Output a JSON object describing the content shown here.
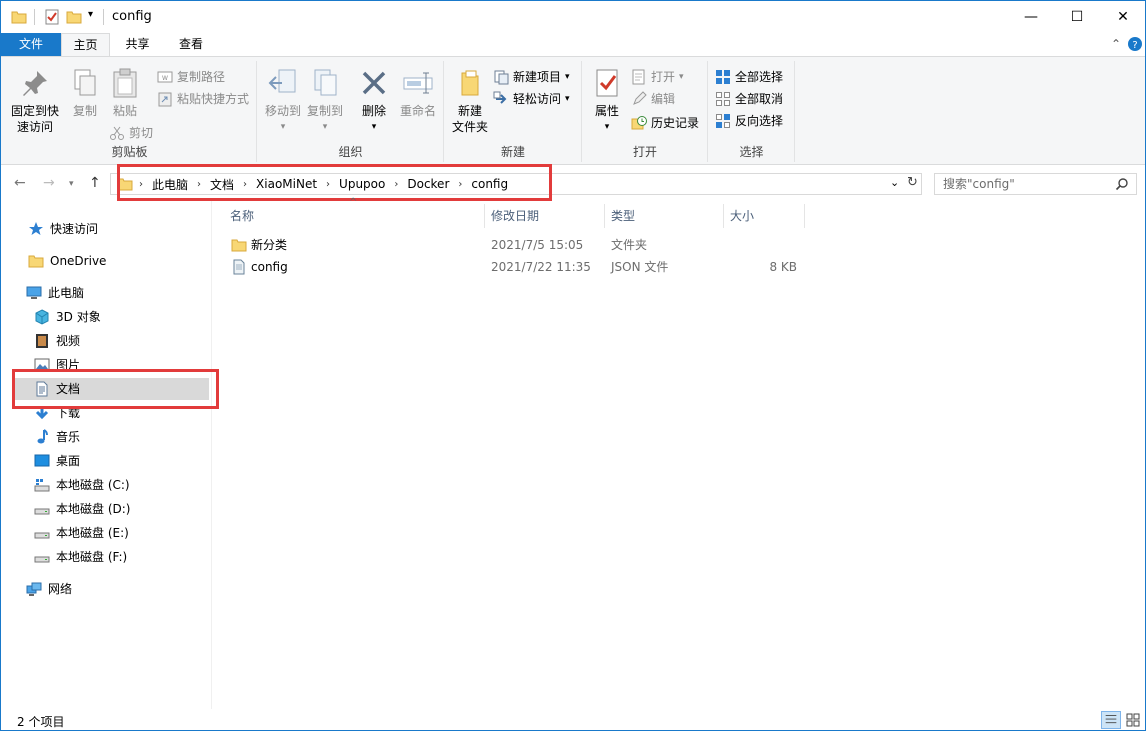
{
  "window": {
    "title": "config",
    "minimize_glyph": "—",
    "maximize_glyph": "☐",
    "close_glyph": "✕"
  },
  "ribbon_tabs": {
    "file": "文件",
    "home": "主页",
    "share": "共享",
    "view": "查看"
  },
  "ribbon": {
    "clipboard": {
      "label": "剪贴板",
      "pin_line1": "固定到快",
      "pin_line2": "速访问",
      "copy": "复制",
      "paste": "粘贴",
      "copy_path": "复制路径",
      "paste_shortcut": "粘贴快捷方式",
      "cut": "剪切"
    },
    "organize": {
      "label": "组织",
      "move_to": "移动到",
      "copy_to": "复制到",
      "delete": "删除",
      "rename": "重命名"
    },
    "new": {
      "label": "新建",
      "new_folder_line1": "新建",
      "new_folder_line2": "文件夹",
      "new_item": "新建项目",
      "easy_access": "轻松访问"
    },
    "open": {
      "label": "打开",
      "properties": "属性",
      "open": "打开",
      "edit": "编辑",
      "history": "历史记录"
    },
    "select": {
      "label": "选择",
      "select_all": "全部选择",
      "select_none": "全部取消",
      "invert": "反向选择"
    }
  },
  "address": {
    "crumbs": [
      "此电脑",
      "文档",
      "XiaoMiNet",
      "Upupoo",
      "Docker",
      "config"
    ]
  },
  "search": {
    "placeholder": "搜索\"config\""
  },
  "nav": {
    "quick_access": "快速访问",
    "onedrive": "OneDrive",
    "this_pc": "此电脑",
    "objects3d": "3D 对象",
    "videos": "视频",
    "pictures": "图片",
    "documents": "文档",
    "downloads": "下载",
    "music": "音乐",
    "desktop": "桌面",
    "drive_c": "本地磁盘 (C:)",
    "drive_d": "本地磁盘 (D:)",
    "drive_e": "本地磁盘 (E:)",
    "drive_f": "本地磁盘 (F:)",
    "network": "网络"
  },
  "columns": {
    "name": "名称",
    "modified": "修改日期",
    "type": "类型",
    "size": "大小"
  },
  "files": [
    {
      "name": "新分类",
      "modified": "2021/7/5 15:05",
      "type": "文件夹",
      "size": "",
      "icon": "folder-icon"
    },
    {
      "name": "config",
      "modified": "2021/7/22 11:35",
      "type": "JSON 文件",
      "size": "8 KB",
      "icon": "json-file-icon"
    }
  ],
  "status": {
    "item_count": "2 个项目"
  },
  "colors": {
    "accent": "#1979ca",
    "highlight_box": "#e23b3b",
    "folder": "#f8d775"
  }
}
